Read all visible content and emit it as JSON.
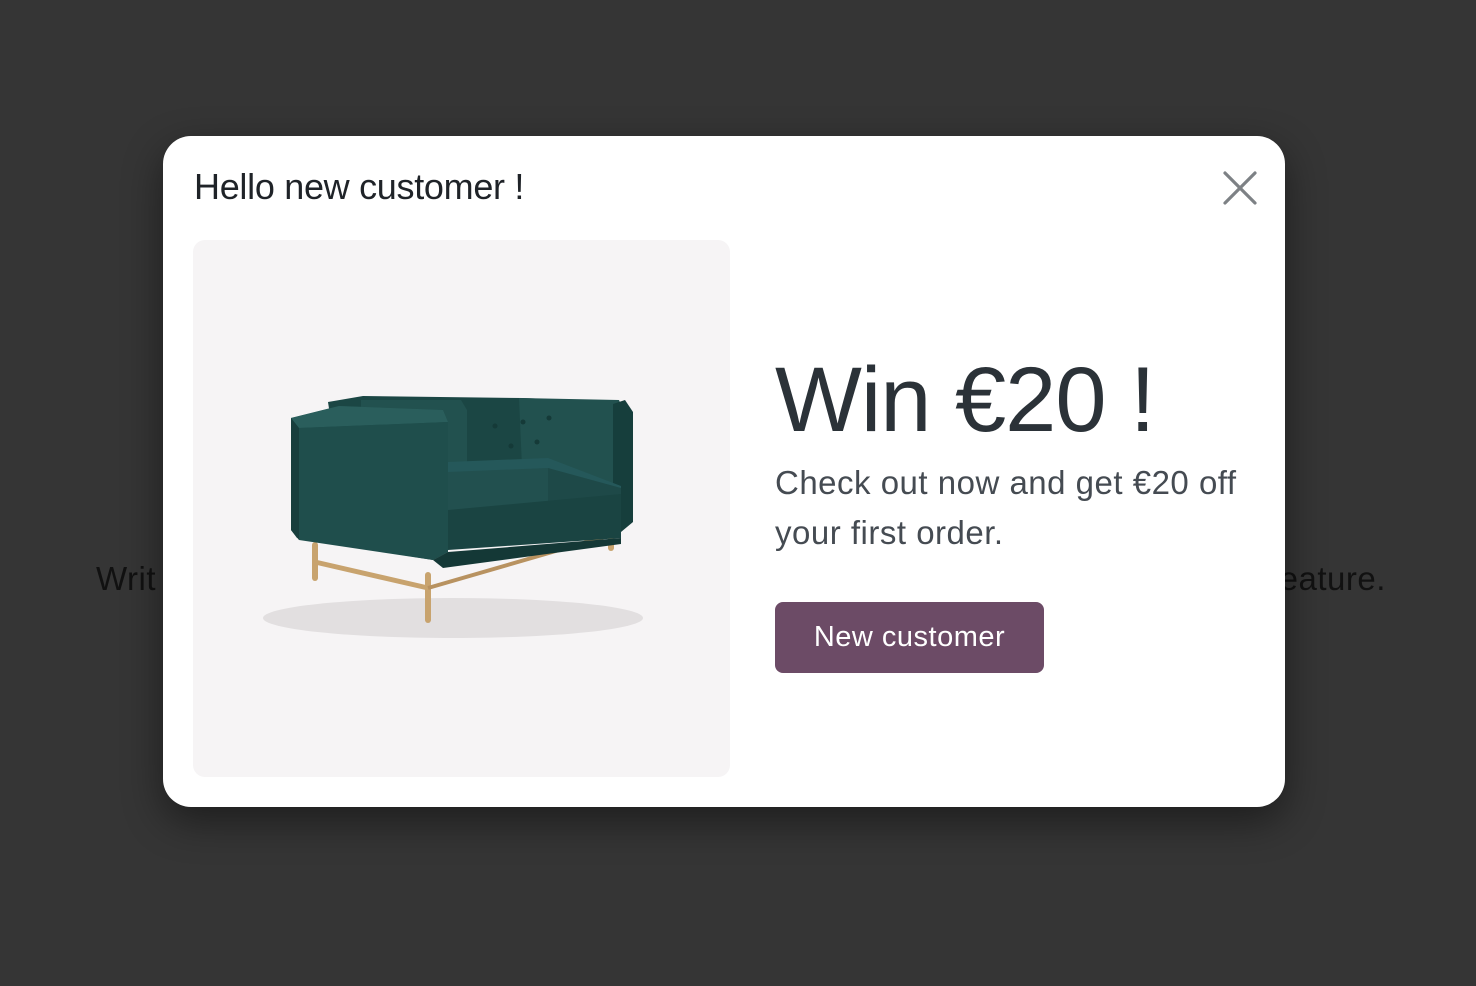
{
  "background": {
    "text_left": "Writ",
    "text_right": "feature."
  },
  "modal": {
    "title": "Hello new customer !",
    "close_icon": "close-icon",
    "image_icon": "sofa-image",
    "headline": "Win €20 !",
    "subtext": "Check out now and get €20 off your first order.",
    "button_label": "New customer"
  },
  "colors": {
    "overlay": "#353535",
    "modal_background": "#ffffff",
    "button_background": "#6c4b66",
    "sofa": "#1e4e4c"
  }
}
